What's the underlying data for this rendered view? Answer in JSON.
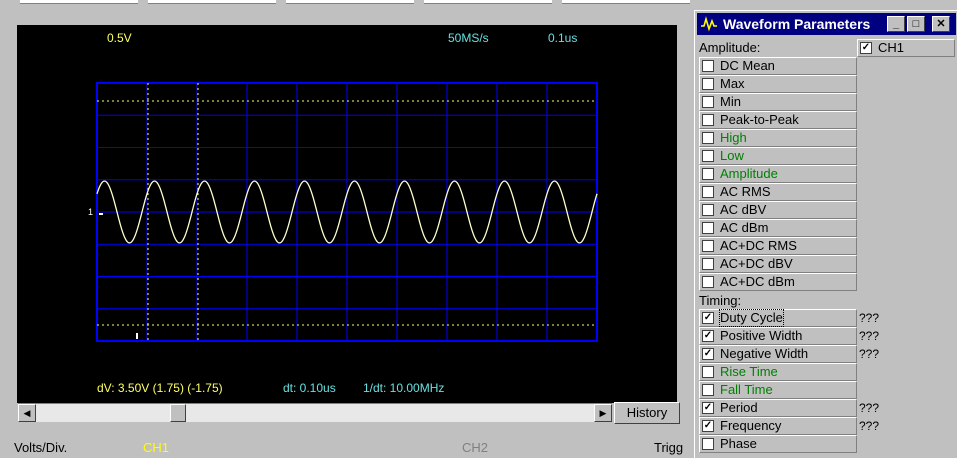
{
  "scope": {
    "volts_per_div": "0.5V",
    "sample_rate": "50MS/s",
    "time_per_div": "0.1us",
    "channel_marker": "1",
    "dv_readout": "dV: 3.50V (1.75) (-1.75)",
    "dt_readout": "dt: 0.10us",
    "freq_readout": "1/dt: 10.00MHz",
    "history_label": "History",
    "trace_color": "#ffffcc",
    "grid_color": "#0000ff",
    "cursor_h_color": "#ffff66",
    "cursor_v_color": "#ffff66",
    "waveform": {
      "type": "sine",
      "cycles_visible": 10,
      "amplitude_divs": 1.6
    }
  },
  "bottom": {
    "volts_div_label": "Volts/Div.",
    "ch1_label": "CH1",
    "ch2_label": "CH2",
    "trigger_label": "Trigg"
  },
  "wp": {
    "title": "Waveform Parameters",
    "minimize": "_",
    "maximize": "□",
    "close": "✕",
    "amplitude_header": "Amplitude:",
    "ch1_header": "CH1",
    "ch1_checked": true,
    "timing_header": "Timing:",
    "amplitude_items": [
      {
        "label": "DC  Mean",
        "checked": false,
        "green": false,
        "value": ""
      },
      {
        "label": "Max",
        "checked": false,
        "green": false,
        "value": ""
      },
      {
        "label": "Min",
        "checked": false,
        "green": false,
        "value": ""
      },
      {
        "label": "Peak-to-Peak",
        "checked": false,
        "green": false,
        "value": ""
      },
      {
        "label": "High",
        "checked": false,
        "green": true,
        "value": ""
      },
      {
        "label": "Low",
        "checked": false,
        "green": true,
        "value": ""
      },
      {
        "label": "Amplitude",
        "checked": false,
        "green": true,
        "value": ""
      },
      {
        "label": "AC RMS",
        "checked": false,
        "green": false,
        "value": ""
      },
      {
        "label": "AC dBV",
        "checked": false,
        "green": false,
        "value": ""
      },
      {
        "label": "AC dBm",
        "checked": false,
        "green": false,
        "value": ""
      },
      {
        "label": "AC+DC RMS",
        "checked": false,
        "green": false,
        "value": ""
      },
      {
        "label": "AC+DC dBV",
        "checked": false,
        "green": false,
        "value": ""
      },
      {
        "label": "AC+DC dBm",
        "checked": false,
        "green": false,
        "value": ""
      }
    ],
    "timing_items": [
      {
        "label": "Duty Cycle",
        "checked": true,
        "green": false,
        "value": "???"
      },
      {
        "label": "Positive Width",
        "checked": true,
        "green": false,
        "value": "???"
      },
      {
        "label": "Negative Width",
        "checked": true,
        "green": false,
        "value": "???"
      },
      {
        "label": "Rise Time",
        "checked": false,
        "green": true,
        "value": ""
      },
      {
        "label": "Fall Time",
        "checked": false,
        "green": true,
        "value": ""
      },
      {
        "label": "Period",
        "checked": true,
        "green": false,
        "value": "???"
      },
      {
        "label": "Frequency",
        "checked": true,
        "green": false,
        "value": "???"
      },
      {
        "label": "Phase",
        "checked": false,
        "green": false,
        "value": ""
      }
    ]
  }
}
